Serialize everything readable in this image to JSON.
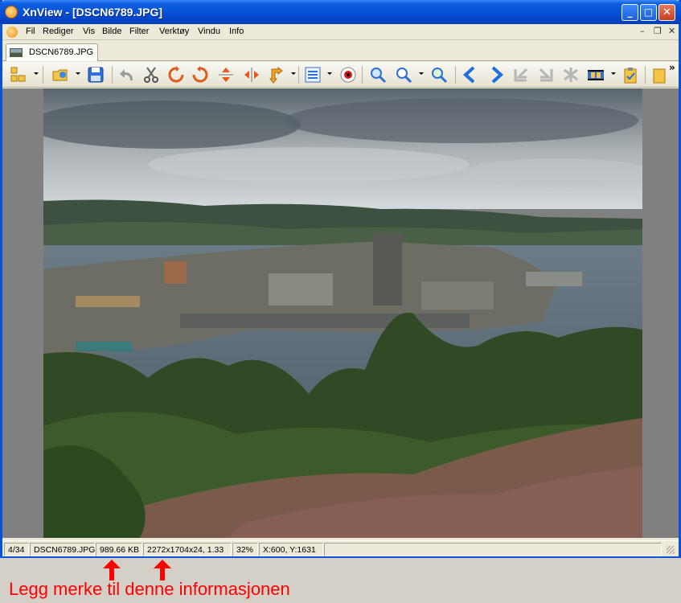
{
  "window": {
    "title": "XnView - [DSCN6789.JPG]",
    "min_label": "_",
    "max_label": "□",
    "close_label": "✕"
  },
  "menu": {
    "items": [
      "Fil",
      "Rediger",
      "Vis",
      "Bilde",
      "Filter",
      "Verktøy",
      "Vindu",
      "Info"
    ],
    "mdi_min": "–",
    "mdi_restore": "❐",
    "mdi_close": "✕"
  },
  "tab": {
    "label": "DSCN6789.JPG"
  },
  "toolbar": {
    "icons": [
      "browser-icon",
      "open-icon",
      "save-icon",
      "undo-icon",
      "cut-icon",
      "rotate-left-icon",
      "rotate-right-icon",
      "flip-vertical-icon",
      "flip-horizontal-icon",
      "transform-icon",
      "adjust-icon",
      "red-eye-icon",
      "zoom-in-icon",
      "zoom-icon",
      "zoom-fit-icon",
      "previous-icon",
      "next-icon",
      "first-icon",
      "last-icon",
      "slideshow-icon",
      "filmstrip-icon",
      "clipboard-icon"
    ],
    "overflow": "»"
  },
  "status": {
    "position": "4/34",
    "filename": "DSCN6789.JPG",
    "filesize": "989.66 KB",
    "dimensions": "2272x1704x24, 1.33",
    "zoom": "32%",
    "coords": "X:600, Y:1631"
  },
  "annotation": {
    "note": "Legg merke til denne informasjonen",
    "color": "#ff0000"
  },
  "colors": {
    "title_bar": "#0653d8",
    "viewer_background": "#808080"
  }
}
